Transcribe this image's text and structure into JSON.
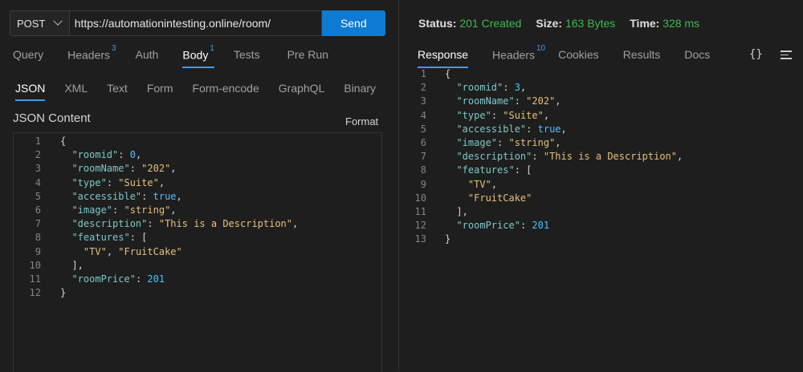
{
  "request": {
    "method": "POST",
    "url": "https://automationintesting.online/room/",
    "send_label": "Send"
  },
  "request_tabs": [
    {
      "label": "Query",
      "badge": ""
    },
    {
      "label": "Headers",
      "badge": "3"
    },
    {
      "label": "Auth",
      "badge": ""
    },
    {
      "label": "Body",
      "badge": "1"
    },
    {
      "label": "Tests",
      "badge": ""
    },
    {
      "label": "Pre Run",
      "badge": ""
    }
  ],
  "body_tabs": [
    "JSON",
    "XML",
    "Text",
    "Form",
    "Form-encode",
    "GraphQL",
    "Binary"
  ],
  "body": {
    "section_title": "JSON Content",
    "format_label": "Format"
  },
  "request_json": [
    "{",
    "\"roomid\": 0,",
    "\"roomName\": \"202\",",
    "\"type\": \"Suite\",",
    "\"accessible\": true,",
    "\"image\": \"string\",",
    "\"description\": \"This is a Description\",",
    "\"features\": [",
    "\"TV\", \"FruitCake\"",
    "],",
    "\"roomPrice\": 201",
    "}"
  ],
  "response": {
    "status_label": "Status:",
    "status_value": "201 Created",
    "size_label": "Size:",
    "size_value": "163 Bytes",
    "time_label": "Time:",
    "time_value": "328 ms"
  },
  "response_tabs": [
    {
      "label": "Response",
      "badge": ""
    },
    {
      "label": "Headers",
      "badge": "10"
    },
    {
      "label": "Cookies",
      "badge": ""
    },
    {
      "label": "Results",
      "badge": ""
    },
    {
      "label": "Docs",
      "badge": ""
    }
  ],
  "response_json": [
    "{",
    "\"roomid\": 3,",
    "\"roomName\": \"202\",",
    "\"type\": \"Suite\",",
    "\"accessible\": true,",
    "\"image\": \"string\",",
    "\"description\": \"This is a Description\",",
    "\"features\": [",
    "\"TV\",",
    "\"FruitCake\"",
    "],",
    "\"roomPrice\": 201",
    "}"
  ],
  "icons": {
    "braces": "{}",
    "menu": "menu-icon",
    "chevron": "chevron-down-icon"
  },
  "colors": {
    "accent": "#0e7ad3",
    "status_ok": "#3fb950",
    "key": "#7ec8c8",
    "string": "#e5c07b",
    "number": "#4fc1ff"
  }
}
